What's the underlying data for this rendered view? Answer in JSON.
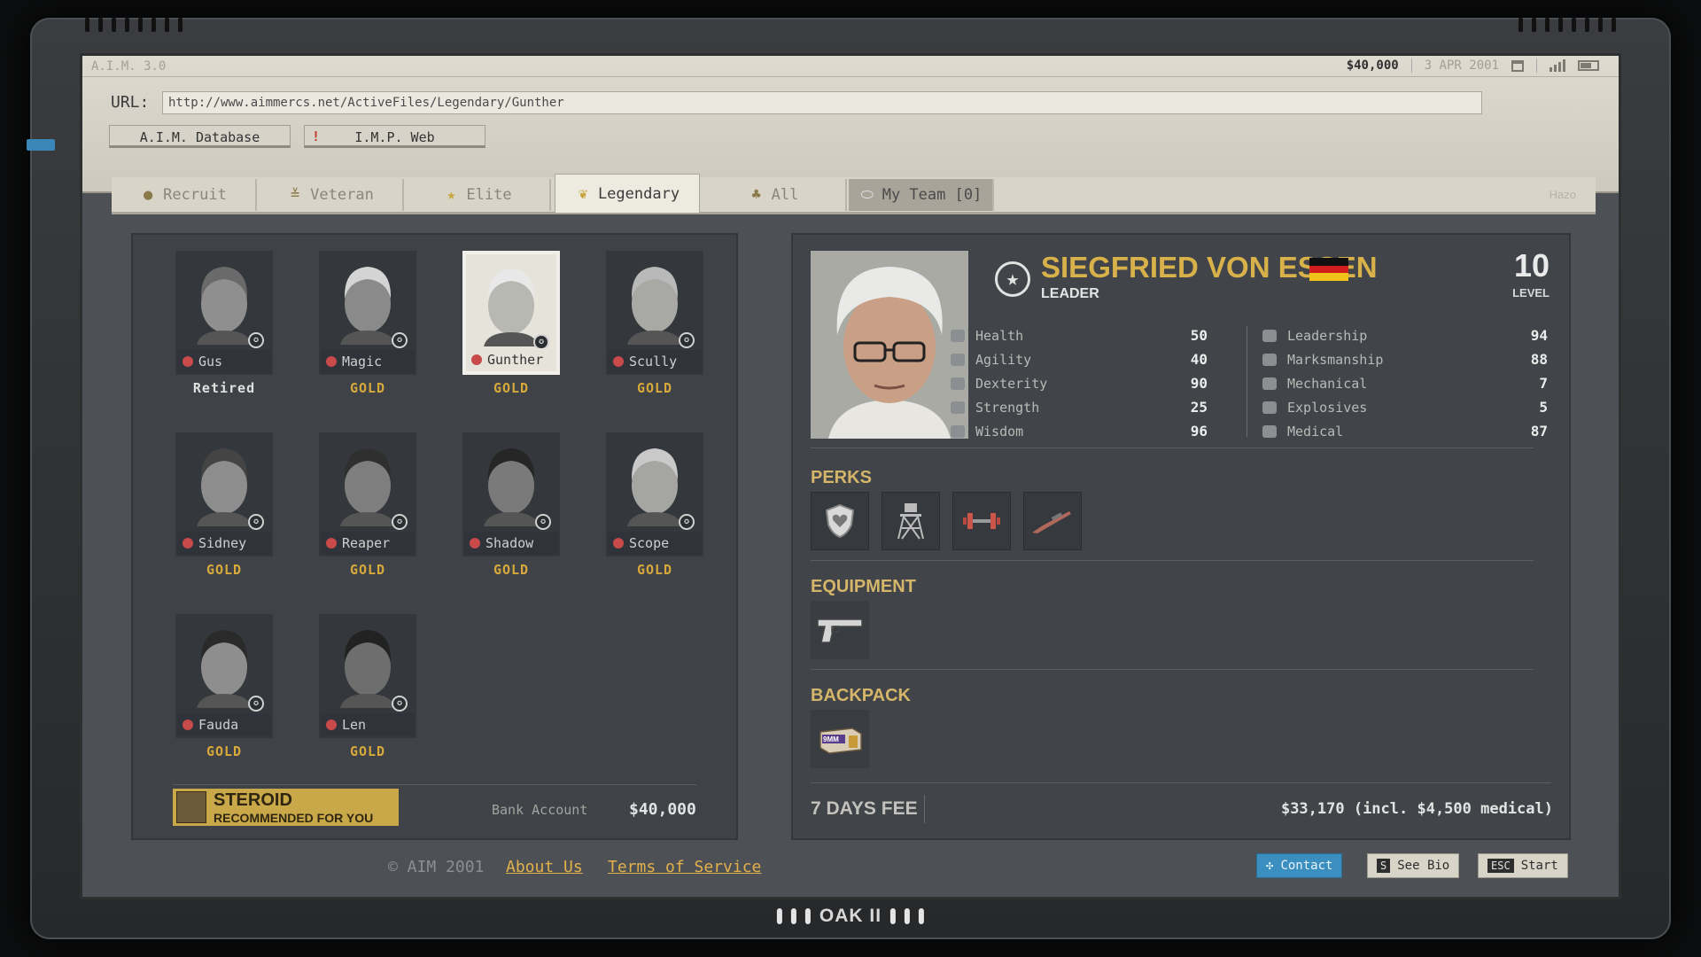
{
  "app": {
    "version": "A.I.M. 3.0",
    "money": "$40,000",
    "date": "3 APR 2001",
    "brand_badge": "OAK II"
  },
  "url": {
    "label": "URL:",
    "value": "http://www.aimmercs.net/ActiveFiles/Legendary/Gunther"
  },
  "nav": {
    "tabs": [
      {
        "label": "A.I.M. Database"
      },
      {
        "label": "I.M.P. Web",
        "warn": "!"
      }
    ]
  },
  "categories": [
    {
      "label": "Recruit",
      "icon": "helmet-icon"
    },
    {
      "label": "Veteran",
      "icon": "chevron-rank-icon"
    },
    {
      "label": "Elite",
      "icon": "star-icon"
    },
    {
      "label": "Legendary",
      "icon": "wings-icon"
    },
    {
      "label": "All",
      "icon": "group-icon"
    },
    {
      "label": "My Team [0]",
      "icon": "pill-icon"
    }
  ],
  "watermark": "Hazo",
  "mercs": [
    {
      "name": "Gus",
      "tier": "Retired"
    },
    {
      "name": "Magic",
      "tier": "GOLD"
    },
    {
      "name": "Gunther",
      "tier": "GOLD"
    },
    {
      "name": "Scully",
      "tier": "GOLD"
    },
    {
      "name": "Sidney",
      "tier": "GOLD"
    },
    {
      "name": "Reaper",
      "tier": "GOLD"
    },
    {
      "name": "Shadow",
      "tier": "GOLD"
    },
    {
      "name": "Scope",
      "tier": "GOLD"
    },
    {
      "name": "Fauda",
      "tier": "GOLD"
    },
    {
      "name": "Len",
      "tier": "GOLD"
    }
  ],
  "ad": {
    "title": "STEROID",
    "subtitle": "RECOMMENDED FOR YOU"
  },
  "bank": {
    "label": "Bank Account",
    "value": "$40,000"
  },
  "detail": {
    "name": "SIEGFRIED VON ESSEN",
    "role": "LEADER",
    "level": "10",
    "level_label": "LEVEL",
    "stats_left": [
      {
        "label": "Health",
        "value": "50"
      },
      {
        "label": "Agility",
        "value": "40"
      },
      {
        "label": "Dexterity",
        "value": "90"
      },
      {
        "label": "Strength",
        "value": "25"
      },
      {
        "label": "Wisdom",
        "value": "96"
      }
    ],
    "stats_right": [
      {
        "label": "Leadership",
        "value": "94"
      },
      {
        "label": "Marksmanship",
        "value": "88"
      },
      {
        "label": "Mechanical",
        "value": "7"
      },
      {
        "label": "Explosives",
        "value": "5"
      },
      {
        "label": "Medical",
        "value": "87"
      }
    ],
    "perks_title": "PERKS",
    "perks": [
      "shield-heart-icon",
      "watchtower-icon",
      "dumbbell-icon",
      "rifle-icon"
    ],
    "equipment_title": "EQUIPMENT",
    "equipment": [
      "pistol-icon"
    ],
    "backpack_title": "BACKPACK",
    "backpack": [
      "ammo-box-9mm-icon"
    ],
    "backpack_box_label": "9MM",
    "fee_title": "7 DAYS FEE",
    "fee_value": "$33,170 (incl. $4,500 medical)"
  },
  "footer": {
    "copyright": "© AIM 2001",
    "about": "About Us",
    "terms": "Terms of Service",
    "contact": "Contact",
    "bio_key": "S",
    "bio": "See Bio",
    "start_key": "ESC",
    "start": "Start"
  },
  "colors": {
    "accent_gold": "#d8b14a",
    "tier_gold": "#d7a83a",
    "contact_blue": "#3a8fc0",
    "status_red": "#c84a4a"
  }
}
